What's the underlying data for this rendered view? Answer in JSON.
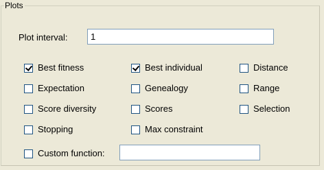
{
  "panel": {
    "title": "Plots"
  },
  "plot_interval": {
    "label": "Plot interval:",
    "value": "1"
  },
  "checkboxes": [
    {
      "label": "Best fitness",
      "checked": true
    },
    {
      "label": "Best individual",
      "checked": true
    },
    {
      "label": "Distance",
      "checked": false
    },
    {
      "label": "Expectation",
      "checked": false
    },
    {
      "label": "Genealogy",
      "checked": false
    },
    {
      "label": "Range",
      "checked": false
    },
    {
      "label": "Score diversity",
      "checked": false
    },
    {
      "label": "Scores",
      "checked": false
    },
    {
      "label": "Selection",
      "checked": false
    },
    {
      "label": "Stopping",
      "checked": false
    },
    {
      "label": "Max constraint",
      "checked": false
    }
  ],
  "custom_function": {
    "label": "Custom function:",
    "checked": false,
    "value": ""
  }
}
